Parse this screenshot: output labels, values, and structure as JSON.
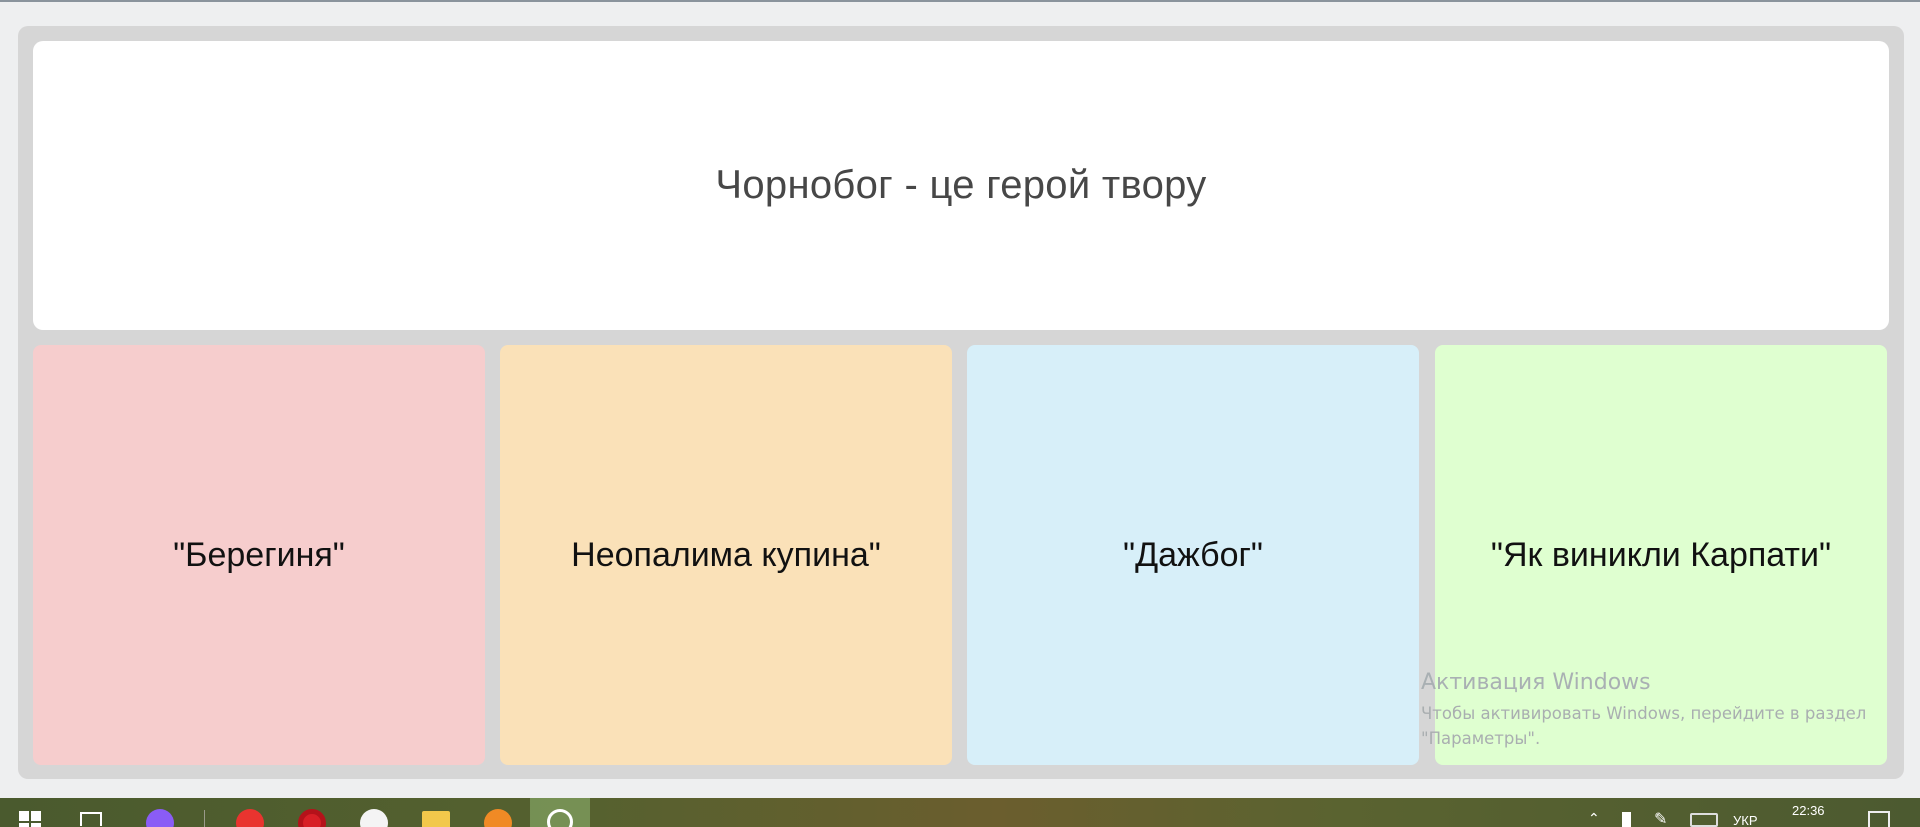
{
  "question": {
    "text": "Чорнобог - це герой твору"
  },
  "answers": [
    {
      "label": "\"Берегиня\"",
      "color": "#f6cdcd"
    },
    {
      "label": "Неопалима купина\"",
      "color": "#fae1b8"
    },
    {
      "label": "\"Дажбог\"",
      "color": "#d7eff9"
    },
    {
      "label": "\"Як виникли Карпати\"",
      "color": "#dfffd0"
    }
  ],
  "watermark": {
    "title": "Активация Windows",
    "line1": "Чтобы активировать Windows, перейдите в раздел",
    "line2": "\"Параметры\"."
  },
  "taskbar": {
    "icons": [
      "windows-start-icon",
      "task-view-icon",
      "alice-icon",
      "yandex-icon",
      "opera-icon",
      "yandex-browser-icon",
      "file-explorer-icon",
      "firefox-icon",
      "active-app-icon"
    ],
    "tray": {
      "language": "УКР",
      "time": "22:36"
    }
  },
  "colors": {
    "board": "#d6d6d6",
    "question_bg": "#ffffff",
    "page_bg": "#eeeff0"
  }
}
